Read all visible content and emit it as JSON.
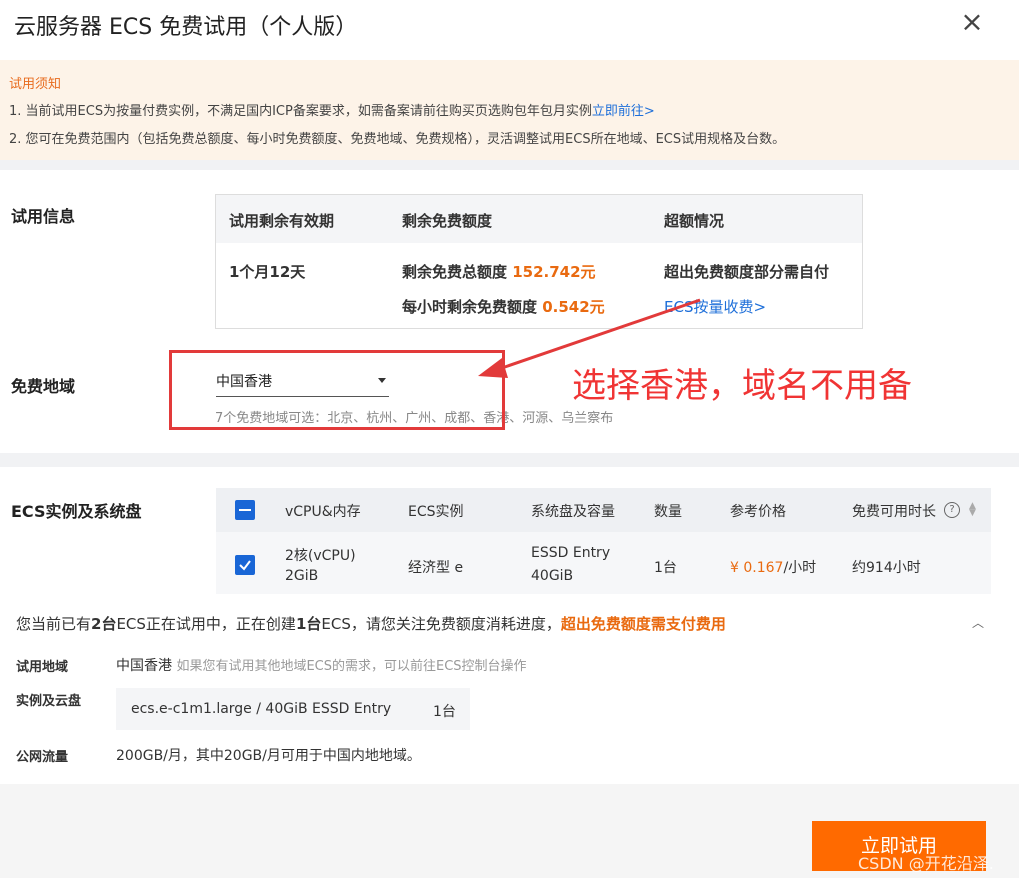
{
  "header": {
    "title": "云服务器 ECS 免费试用（个人版）",
    "close_icon": "×"
  },
  "notice": {
    "title": "试用须知",
    "line1_text": "1. 当前试用ECS为按量付费实例，不满足国内ICP备案要求，如需备案请前往购买页选购包年包月实例",
    "line1_link": "立即前往>",
    "line2_text": "2. 您可在免费范围内（包括免费总额度、每小时免费额度、免费地域、免费规格），灵活调整试用ECS所在地域、ECS试用规格及台数。"
  },
  "trial_info": {
    "label": "试用信息",
    "headers": [
      "试用剩余有效期",
      "剩余免费额度",
      "超额情况"
    ],
    "validity": "1个月12天",
    "total_label": "剩余免费总额度 ",
    "total_value": "152.742元",
    "hourly_label": "每小时剩余免费额度 ",
    "hourly_value": "0.542元",
    "overage_text": "超出免费额度部分需自付",
    "overage_link": "ECS按量收费>"
  },
  "free_region": {
    "label": "免费地域",
    "selected": "中国香港",
    "hint": "7个免费地域可选：北京、杭州、广州、成都、香港、河源、乌兰察布",
    "annotation": "选择香港，域名不用备"
  },
  "instances": {
    "label": "ECS实例及系统盘",
    "headers": [
      "vCPU&内存",
      "ECS实例",
      "系统盘及容量",
      "数量",
      "参考价格",
      "免费可用时长"
    ],
    "row": {
      "cpu_line1": "2核(vCPU)",
      "cpu_line2": "2GiB",
      "instance": "经济型 e",
      "disk_line1": "ESSD Entry",
      "disk_line2": "40GiB",
      "qty": "1台",
      "price": "¥ 0.167",
      "price_unit": "/小时",
      "duration": "约914小时"
    }
  },
  "summary": {
    "main_pre": "您当前已有",
    "main_count1": "2台",
    "main_mid": "ECS正在试用中，正在创建",
    "main_count2": "1台",
    "main_post": "ECS，请您关注免费额度消耗进度，",
    "main_warn": "超出免费额度需支付费用",
    "region_label": "试用地域",
    "region_value": "中国香港",
    "region_hint": "如果您有试用其他地域ECS的需求，可以前往ECS控制台操作",
    "inst_label": "实例及云盘",
    "inst_value": "ecs.e-c1m1.large / 40GiB ESSD Entry",
    "inst_qty": "1台",
    "traffic_label": "公网流量",
    "traffic_value": "200GB/月，其中20GB/月可用于中国内地地域。"
  },
  "footer": {
    "button": "立即试用",
    "watermark": "CSDN @开花沿泽."
  },
  "colors": {
    "accent": "#ff6a00",
    "link": "#1e6fd9",
    "annotation": "#f03434"
  }
}
